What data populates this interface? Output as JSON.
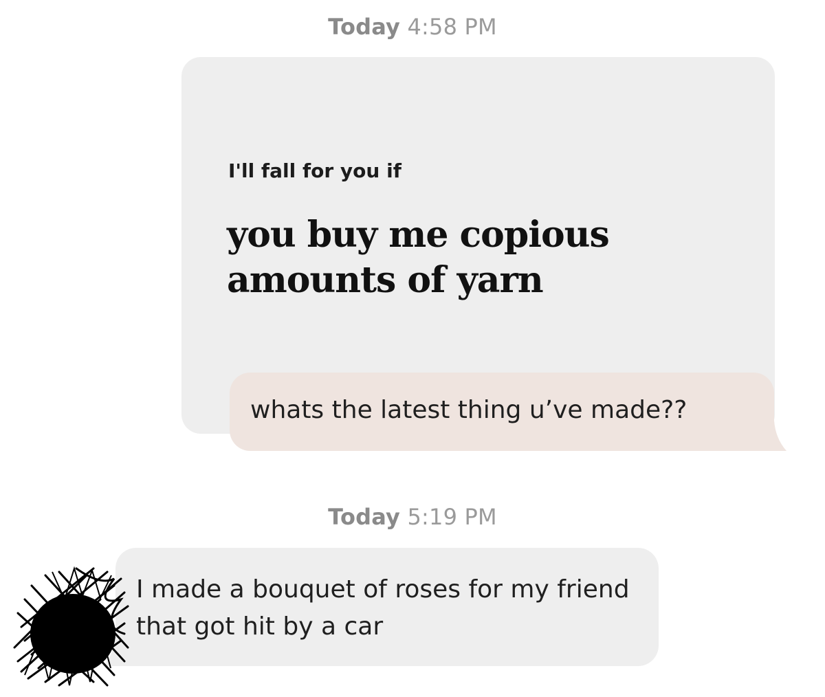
{
  "thread": {
    "first_timestamp": {
      "day": "Today",
      "time": "4:58 PM"
    },
    "prompt": {
      "label": "I'll fall for you if",
      "answer": "you buy me copious amounts of yarn"
    },
    "sent_message": "whats the latest thing u’ve made??",
    "second_timestamp": {
      "day": "Today",
      "time": "5:19 PM"
    },
    "received_message": "I made a bouquet of roses for my friend that got hit by a car"
  },
  "colors": {
    "background": "#ffffff",
    "card": "#eeeeee",
    "sent_bubble": "#efe4df",
    "received_bubble": "#eeeeee",
    "timestamp": "#8c8c8c"
  },
  "icons": {
    "avatar": "scribbled-avatar-icon"
  }
}
